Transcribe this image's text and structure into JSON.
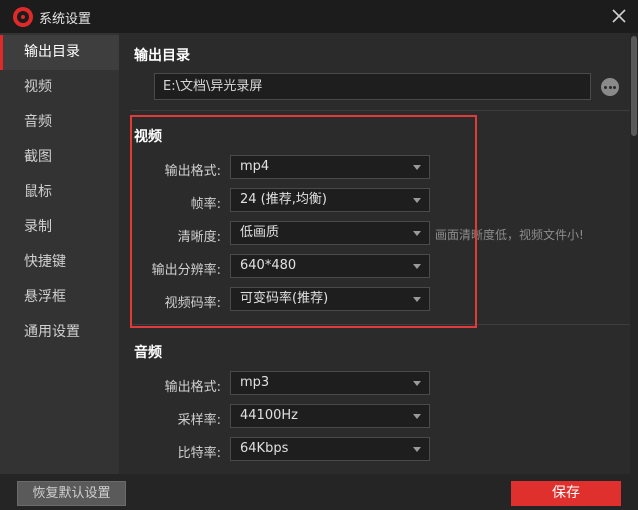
{
  "window": {
    "title": "系统设置",
    "icons": {
      "logo": "app-logo-icon",
      "close": "close-icon"
    }
  },
  "sidebar": {
    "items": [
      {
        "label": "输出目录",
        "active": true
      },
      {
        "label": "视频"
      },
      {
        "label": "音频"
      },
      {
        "label": "截图"
      },
      {
        "label": "鼠标"
      },
      {
        "label": "录制"
      },
      {
        "label": "快捷键"
      },
      {
        "label": "悬浮框"
      },
      {
        "label": "通用设置"
      }
    ]
  },
  "output_dir": {
    "title": "输出目录",
    "path": "E:\\文档\\异光录屏",
    "more_icon": "more-icon"
  },
  "video": {
    "title": "视频",
    "format": {
      "label": "输出格式:",
      "value": "mp4"
    },
    "framerate": {
      "label": "帧率:",
      "value": "24 (推荐,均衡)"
    },
    "quality": {
      "label": "清晰度:",
      "value": "低画质",
      "hint": "画面清晰度低，视频文件小!"
    },
    "resolution": {
      "label": "输出分辨率:",
      "value": "640*480"
    },
    "bitrate": {
      "label": "视频码率:",
      "value": "可变码率(推荐)"
    }
  },
  "audio": {
    "title": "音频",
    "format": {
      "label": "输出格式:",
      "value": "mp3"
    },
    "samplerate": {
      "label": "采样率:",
      "value": "44100Hz"
    },
    "bitrate": {
      "label": "比特率:",
      "value": "64Kbps"
    }
  },
  "footer": {
    "restore_label": "恢复默认设置",
    "save_label": "保存"
  },
  "colors": {
    "accent": "#e0302e",
    "highlight_border": "#e03b3b",
    "background": "#2b2b2b",
    "sidebar": "#333333"
  }
}
